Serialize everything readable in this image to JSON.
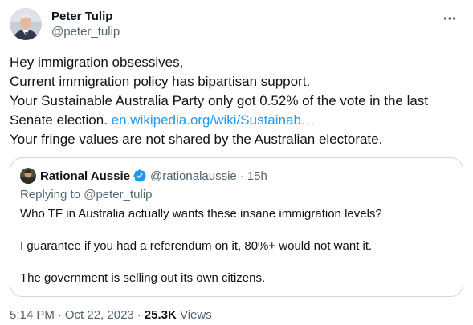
{
  "author": {
    "name": "Peter Tulip",
    "handle": "@peter_tulip"
  },
  "tweet": {
    "lines": [
      "Hey immigration obsessives,",
      "Current immigration policy has bipartisan support.",
      "Your Sustainable Australia Party only got 0.52% of the vote in the last",
      "Senate election. ",
      "Your fringe values are not shared by the Australian electorate."
    ],
    "link": "en.wikipedia.org/wiki/Sustainab…"
  },
  "quote": {
    "name": "Rational Aussie",
    "handle": "@rationalaussie",
    "dot": "·",
    "time": "15h",
    "replying_to": "Replying to @peter_tulip",
    "paragraphs": [
      "Who TF in Australia actually wants these insane immigration levels?",
      "I guarantee if you had a referendum on it, 80%+ would not want it.",
      "The government is selling out its own citizens."
    ]
  },
  "meta": {
    "time": "5:14 PM",
    "sep": "·",
    "date": "Oct 22, 2023",
    "views_count": "25.3K",
    "views_label": " Views"
  },
  "icons": {
    "more": "more-options-icon",
    "verified": "verified-badge-icon"
  },
  "colors": {
    "link": "#1d9bf0",
    "secondary_text": "#536471",
    "border": "#cfd9de"
  }
}
